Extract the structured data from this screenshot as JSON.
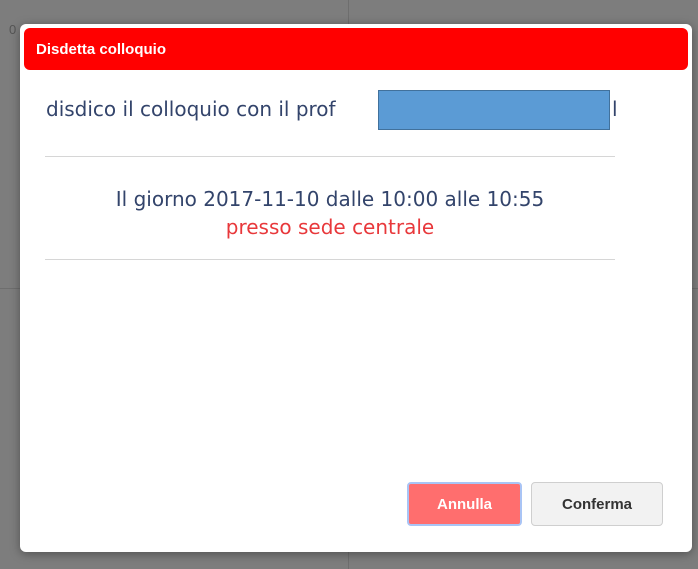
{
  "backdrop": {
    "ghost_text": "0"
  },
  "modal": {
    "title": "Disdetta colloquio",
    "message": "disdico il colloquio con il prof",
    "message_tail": "l",
    "date_text": "Il giorno 2017-11-10 dalle 10:00 alle 10:55",
    "place_text": "presso sede centrale",
    "buttons": {
      "cancel_label": "Annulla",
      "confirm_label": "Conferma"
    }
  },
  "colors": {
    "header": "#ff0000",
    "text": "#33446b",
    "place": "#e8383b",
    "cancel_button": "#ff6e6e",
    "redaction": "#5b9bd5"
  }
}
